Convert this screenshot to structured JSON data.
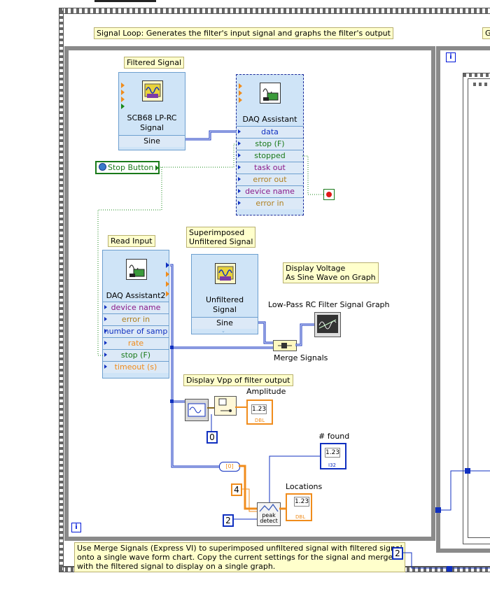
{
  "outer": {
    "loop_note": "Signal Loop: Generates the filter's input signal and graphs the filter's output",
    "right_note_fragment": "G",
    "bottom_note": "Use Merge Signals (Express VI) to superimposed unfiltered signal with filtered signal\nonto a single wave form chart. Copy the current settings for the signal and merge\nwith the filtered signal to display on a single graph.",
    "const_2_outer": "2"
  },
  "loop": {
    "iteration_icon": "i",
    "right_iteration_icon": "i"
  },
  "filtered_signal": {
    "label": "Filtered Signal",
    "title": "SCB68 LP-RC\nSignal",
    "output": "Sine"
  },
  "daq_assistant": {
    "title": "DAQ Assistant",
    "rows": [
      "data",
      "stop (F)",
      "stopped",
      "task out",
      "error out",
      "device name",
      "error in"
    ],
    "row_colors": [
      "#1030c0",
      "#1a7a1a",
      "#1a7a1a",
      "#8a1a8a",
      "#b08020",
      "#8a1a8a",
      "#b08020"
    ]
  },
  "stop_button": {
    "label": "Stop Button"
  },
  "read_input": {
    "label": "Read Input",
    "title": "DAQ Assistant2",
    "rows": [
      "device name",
      "error in",
      "number of samp",
      "rate",
      "stop (F)",
      "timeout (s)"
    ],
    "row_colors": [
      "#8a1a8a",
      "#b08020",
      "#1030c0",
      "#f08c1c",
      "#1a7a1a",
      "#f08c1c"
    ]
  },
  "unfiltered_signal": {
    "label": "Superimposed\nUnfiltered Signal",
    "title": "Unfiltered\nSignal",
    "output": "Sine"
  },
  "display_voltage_note": "Display Voltage\nAs Sine Wave on Graph",
  "graph_label": "Low-Pass RC Filter Signal Graph",
  "merge_label": "Merge Signals",
  "vpp_note": "Display Vpp of filter output",
  "amplitude_label": "Amplitude",
  "amplitude_indicator": "1.23",
  "amplitude_type": "DBL",
  "const_0": "0",
  "found_label": "# found",
  "found_indicator": "1.23",
  "found_type": "I32",
  "locations_label": "Locations",
  "locations_indicator": "1.23",
  "locations_type": "DBL",
  "const_4": "4",
  "const_2": "2",
  "peak_detect": "peak\ndetect",
  "array_const": "[0]"
}
